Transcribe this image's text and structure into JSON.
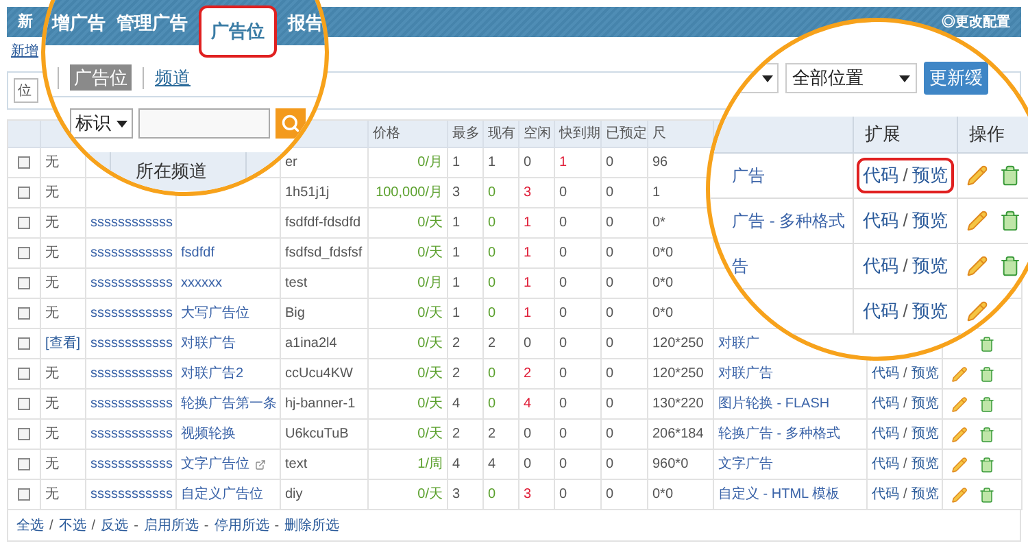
{
  "header": {
    "brand": "新",
    "settings_link": "◎更改配置"
  },
  "add_link": "新增",
  "toolbar": {
    "select": "位"
  },
  "table": {
    "columns": [
      {
        "label": "价格"
      },
      {
        "label": "最多"
      },
      {
        "label": "现有"
      },
      {
        "label": "空闲"
      },
      {
        "label": "快到期"
      },
      {
        "label": "已预定"
      },
      {
        "label": "尺"
      }
    ],
    "rows": [
      {
        "checked": false,
        "ad": "无",
        "ad_link": false,
        "ident": "er",
        "price": "0/月",
        "max": "1",
        "cur": "1",
        "cur_empty": false,
        "free": "0",
        "free_warn": false,
        "exp": "1",
        "exp_warn": true,
        "res": "0",
        "size": "96"
      },
      {
        "checked": false,
        "ad": "无",
        "ad_link": false,
        "ident": "1h51j1j",
        "price": "100,000/月",
        "max": "3",
        "cur": "0",
        "cur_empty": true,
        "free": "3",
        "free_warn": true,
        "exp": "0",
        "exp_warn": false,
        "res": "0",
        "size": "1"
      },
      {
        "checked": false,
        "ad": "无",
        "ad_link": false,
        "channel": "ssssssssssss",
        "ident": "fsdfdf-fdsdfd",
        "price": "0/天",
        "max": "1",
        "cur": "0",
        "cur_empty": true,
        "free": "1",
        "free_warn": true,
        "exp": "0",
        "exp_warn": false,
        "res": "0",
        "size": "0*"
      },
      {
        "checked": false,
        "ad": "无",
        "ad_link": false,
        "channel": "ssssssssssss",
        "name": "fsdfdf",
        "ident": "fsdfsd_fdsfsf",
        "price": "0/天",
        "max": "1",
        "cur": "0",
        "cur_empty": true,
        "free": "1",
        "free_warn": true,
        "exp": "0",
        "exp_warn": false,
        "res": "0",
        "size": "0*0"
      },
      {
        "checked": false,
        "ad": "无",
        "ad_link": false,
        "channel": "ssssssssssss",
        "name": "xxxxxx",
        "ident": "test",
        "price": "0/月",
        "max": "1",
        "cur": "0",
        "cur_empty": true,
        "free": "1",
        "free_warn": true,
        "exp": "0",
        "exp_warn": false,
        "res": "0",
        "size": "0*0"
      },
      {
        "checked": false,
        "ad": "无",
        "ad_link": false,
        "channel": "ssssssssssss",
        "name": "大写广告位",
        "ident": "Big",
        "price": "0/天",
        "max": "1",
        "cur": "0",
        "cur_empty": true,
        "free": "1",
        "free_warn": true,
        "exp": "0",
        "exp_warn": false,
        "res": "0",
        "size": "0*0"
      },
      {
        "checked": false,
        "ad": "[查看]",
        "ad_link": true,
        "channel": "ssssssssssss",
        "name": "对联广告",
        "ident": "a1ina2l4",
        "price": "0/天",
        "max": "2",
        "cur": "2",
        "cur_empty": false,
        "free": "0",
        "free_warn": false,
        "exp": "0",
        "exp_warn": false,
        "res": "0",
        "size": "120*250",
        "type": "对联广",
        "ops": {
          "edit": false,
          "delete": true
        }
      },
      {
        "checked": false,
        "ad": "无",
        "ad_link": false,
        "channel": "ssssssssssss",
        "name": "对联广告2",
        "ident": "ccUcu4KW",
        "price": "0/天",
        "max": "2",
        "cur": "0",
        "cur_empty": true,
        "free": "2",
        "free_warn": true,
        "exp": "0",
        "exp_warn": false,
        "res": "0",
        "size": "120*250",
        "type": "对联广告",
        "links": [
          "代码",
          "预览"
        ],
        "ops": {
          "edit": true,
          "delete": true
        }
      },
      {
        "checked": false,
        "ad": "无",
        "ad_link": false,
        "channel": "ssssssssssss",
        "name": "轮换广告第一条",
        "ident": "hj-banner-1",
        "price": "0/天",
        "max": "4",
        "cur": "0",
        "cur_empty": true,
        "free": "4",
        "free_warn": true,
        "exp": "0",
        "exp_warn": false,
        "res": "0",
        "size": "130*220",
        "type": "图片轮换 - FLASH",
        "links": [
          "代码",
          "预览"
        ],
        "ops": {
          "edit": true,
          "delete": true
        }
      },
      {
        "checked": false,
        "ad": "无",
        "ad_link": false,
        "channel": "ssssssssssss",
        "name": "视频轮换",
        "ident": "U6kcuTuB",
        "price": "0/天",
        "max": "2",
        "cur": "2",
        "cur_empty": false,
        "free": "0",
        "free_warn": false,
        "exp": "0",
        "exp_warn": false,
        "res": "0",
        "size": "206*184",
        "type": "轮换广告 - 多种格式",
        "links": [
          "代码",
          "预览"
        ],
        "ops": {
          "edit": true,
          "delete": true
        }
      },
      {
        "checked": false,
        "ad": "无",
        "ad_link": false,
        "channel": "ssssssssssss",
        "name": "文字广告位",
        "external": true,
        "ident": "text",
        "price": "1/周",
        "max": "4",
        "cur": "4",
        "cur_empty": false,
        "free": "0",
        "free_warn": false,
        "exp": "0",
        "exp_warn": false,
        "res": "0",
        "size": "960*0",
        "type": "文字广告",
        "links": [
          "代码",
          "预览"
        ],
        "ops": {
          "edit": true,
          "delete": true
        }
      },
      {
        "checked": false,
        "ad": "无",
        "ad_link": false,
        "channel": "ssssssssssss",
        "name": "自定义广告位",
        "ident": "diy",
        "price": "0/天",
        "max": "3",
        "cur": "0",
        "cur_empty": true,
        "free": "3",
        "free_warn": true,
        "exp": "0",
        "exp_warn": false,
        "res": "0",
        "size": "0*0",
        "type": "自定义 - HTML 模板",
        "links": [
          "代码",
          "预览"
        ],
        "ops": {
          "edit": true,
          "delete": true
        }
      }
    ],
    "link_separator": "/"
  },
  "footer": [
    {
      "label": "全选"
    },
    {
      "sep": "/",
      "label": "不选"
    },
    {
      "sep": "/",
      "label": "反选"
    },
    {
      "sep": "-",
      "label": "启用所选"
    },
    {
      "sep": "-",
      "label": "停用所选"
    },
    {
      "sep": "-",
      "label": "删除所选"
    }
  ],
  "magnifier_left": {
    "tabs": [
      {
        "label": "增广告",
        "selected": false
      },
      {
        "label": "管理广告",
        "selected": false
      },
      {
        "label": "广告位",
        "selected": true
      },
      {
        "label": "报告",
        "selected": false
      }
    ],
    "subnav": [
      {
        "label": "广告位",
        "selected": true
      },
      {
        "label": "频道",
        "selected": false
      }
    ],
    "search_field": "标识",
    "column": "所在频道"
  },
  "magnifier_right": {
    "location_select": "全部位置",
    "refresh_button": "更新缓",
    "columns": [
      "扩展",
      "操作"
    ],
    "rows": [
      {
        "type": "广告",
        "links": [
          "代码",
          "预览"
        ],
        "highlighted": true,
        "ops": {
          "edit": true,
          "delete": true
        }
      },
      {
        "type": "广告 - 多种格式",
        "links": [
          "代码",
          "预览"
        ],
        "highlighted": false,
        "ops": {
          "edit": true,
          "delete": true
        }
      },
      {
        "type": "告",
        "links": [
          "代码",
          "预览"
        ],
        "highlighted": false,
        "ops": {
          "edit": true,
          "delete": true
        }
      },
      {
        "links": [
          "代码",
          "预览"
        ],
        "highlighted": false,
        "ops": {
          "edit": true,
          "delete": false
        }
      }
    ]
  }
}
